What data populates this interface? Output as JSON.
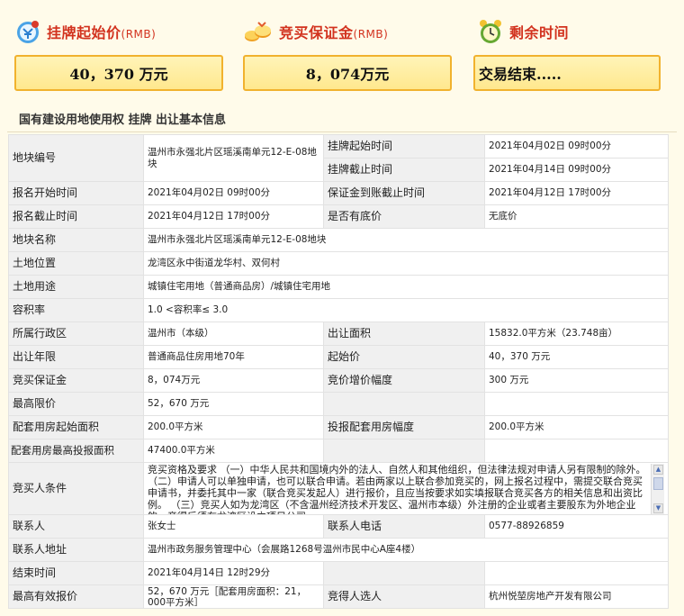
{
  "summary": {
    "start_price": {
      "label": "挂牌起始价",
      "unit": "(RMB)",
      "value": "40，370 万元",
      "icon": "money-bag-icon"
    },
    "deposit": {
      "label": "竞买保证金",
      "unit": "(RMB)",
      "value": "8，074万元",
      "icon": "gold-coins-icon"
    },
    "remaining": {
      "label": "剩余时间",
      "value": "交易结束.....",
      "icon": "alarm-clock-icon"
    }
  },
  "section_title": "国有建设用地使用权 挂牌 出让基本信息",
  "table": {
    "parcel_no": {
      "label": "地块编号",
      "value": "温州市永强北片区瑶溪南单元12-E-08地块"
    },
    "listing_start_time": {
      "label": "挂牌起始时间",
      "value": "2021年04月02日 09时00分"
    },
    "listing_end_time": {
      "label": "挂牌截止时间",
      "value": "2021年04月14日 09时00分"
    },
    "signup_start_time": {
      "label": "报名开始时间",
      "value": "2021年04月02日 09时00分"
    },
    "deposit_deadline": {
      "label": "保证金到账截止时间",
      "value": "2021年04月12日 17时00分"
    },
    "signup_end_time": {
      "label": "报名截止时间",
      "value": "2021年04月12日 17时00分"
    },
    "reserve_price": {
      "label": "是否有底价",
      "value": "无底价"
    },
    "parcel_name": {
      "label": "地块名称",
      "value": "温州市永强北片区瑶溪南单元12-E-08地块"
    },
    "location": {
      "label": "土地位置",
      "value": "龙湾区永中街道龙华村、双何村"
    },
    "land_use": {
      "label": "土地用途",
      "value": "城镇住宅用地（普通商品房）/城镇住宅用地"
    },
    "plot_ratio": {
      "label": "容积率",
      "value": "1.0 <容积率≤ 3.0"
    },
    "district": {
      "label": "所属行政区",
      "value": "温州市（本级）"
    },
    "area": {
      "label": "出让面积",
      "value": "15832.0平方米（23.748亩）"
    },
    "term": {
      "label": "出让年限",
      "value": "普通商品住房用地70年"
    },
    "start_price": {
      "label": "起始价",
      "value": "40，370 万元"
    },
    "bid_deposit": {
      "label": "竞买保证金",
      "value": "8，074万元"
    },
    "increment": {
      "label": "竞价增价幅度",
      "value": "300 万元"
    },
    "max_price": {
      "label": "最高限价",
      "value": "52，670 万元"
    },
    "housing_start_area": {
      "label": "配套用房起始面积",
      "value": "200.0平方米"
    },
    "housing_increment": {
      "label": "投报配套用房幅度",
      "value": "200.0平方米"
    },
    "housing_max_area": {
      "label": "配套用房最高投报面积",
      "value": "47400.0平方米"
    },
    "conditions": {
      "label": "竞买人条件",
      "value": "竞买资格及要求 （一）中华人民共和国境内外的法人、自然人和其他组织，但法律法规对申请人另有限制的除外。 （二）申请人可以单独申请，也可以联合申请。若由两家以上联合参加竞买的，网上报名过程中，需提交联合竞买申请书，并委托其中一家（联合竞买发起人）进行报价，且应当按要求如实填报联合竞买各方的相关信息和出资比例。 （三）竞买人如为龙湾区（不含温州经济技术开发区、温州市本级）外注册的企业或者主要股东为外地企业的，竞得后须在龙湾区设立项目公司。"
    },
    "contact": {
      "label": "联系人",
      "value": "张女士"
    },
    "phone": {
      "label": "联系人电话",
      "value": "0577-88926859"
    },
    "address": {
      "label": "联系人地址",
      "value": "温州市政务服务管理中心（会展路1268号温州市民中心A座4楼）"
    },
    "end_time": {
      "label": "结束时间",
      "value": "2021年04月14日 12时29分"
    },
    "highest_bid": {
      "label": "最高有效报价",
      "value": "52，670 万元［配套用房面积：21，000平方米］"
    },
    "winner": {
      "label": "竞得人选人",
      "value": "杭州悦堃房地产开发有限公司"
    }
  },
  "colors": {
    "accent_red": "#d2321e",
    "box_border": "#f1b22e",
    "box_fill": "#ffe88e",
    "key_bg": "#f0f0f0"
  }
}
